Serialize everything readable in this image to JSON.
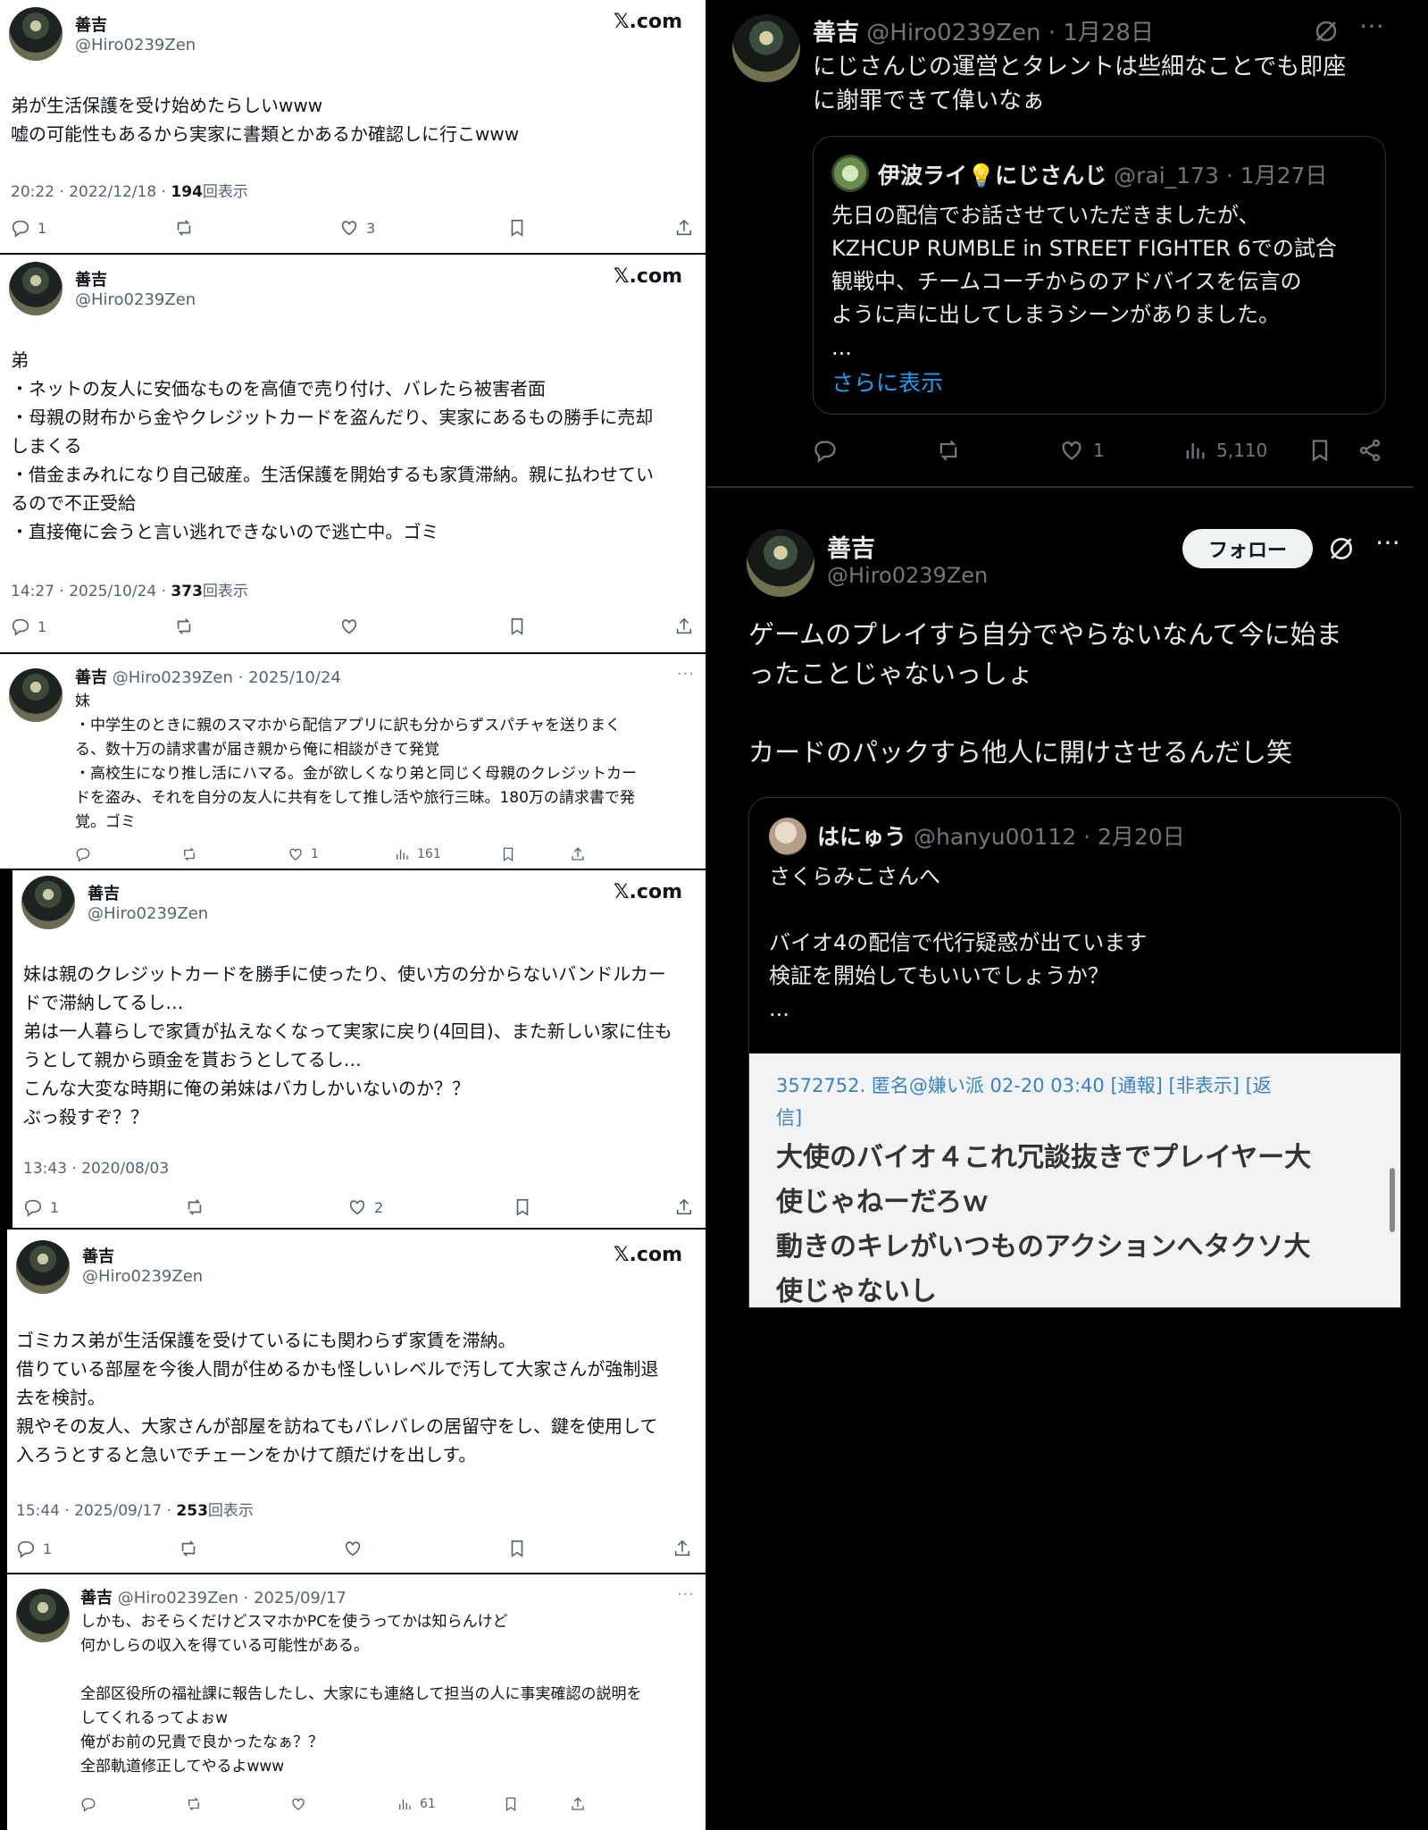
{
  "user": {
    "name": "善吉",
    "handle": "@Hiro0239Zen"
  },
  "xcom": "𝕏.com",
  "left": {
    "card1": {
      "body": "弟が生活保護を受け始めたらしいwww\n嘘の可能性もあるから実家に書類とかあるか確認しに行こwww",
      "time": "20:22 · 2022/12/18 · ",
      "views": "194",
      "views_suffix": "回表示",
      "replies": "1",
      "likes": "3"
    },
    "card2": {
      "body": "弟\n・ネットの友人に安価なものを高値で売り付け、バレたら被害者面\n・母親の財布から金やクレジットカードを盗んだり、実家にあるもの勝手に売却\nしまくる\n・借金まみれになり自己破産。生活保護を開始するも家賃滞納。親に払わせてい\nるので不正受給\n・直接俺に会うと言い逃れできないので逃亡中。ゴミ",
      "time": "14:27 · 2025/10/24 · ",
      "views": "373",
      "views_suffix": "回表示",
      "replies": "1"
    },
    "reply1": {
      "date": "· 2025/10/24",
      "body": "妹\n・中学生のときに親のスマホから配信アプリに訳も分からずスパチャを送りまく\nる、数十万の請求書が届き親から俺に相談がきて発覚\n・高校生になり推し活にハマる。金が欲しくなり弟と同じく母親のクレジットカー\nドを盗み、それを自分の友人に共有をして推し活や旅行三昧。180万の請求書で発\n覚。ゴミ",
      "likes": "1",
      "views": "161",
      "dots": "···"
    },
    "card3": {
      "body": "妹は親のクレジットカードを勝手に使ったり、使い方の分からないバンドルカー\nドで滞納してるし…\n弟は一人暮らしで家賃が払えなくなって実家に戻り(4回目)、また新しい家に住も\nうとして親から頭金を貰おうとしてるし…\nこんな大変な時期に俺の弟妹はバカしかいないのか？？\nぶっ殺すぞ？？",
      "time": "13:43 · 2020/08/03",
      "replies": "1",
      "likes": "2"
    },
    "card4": {
      "body": "ゴミカス弟が生活保護を受けているにも関わらず家賃を滞納。\n借りている部屋を今後人間が住めるかも怪しいレベルで汚して大家さんが強制退\n去を検討。\n親やその友人、大家さんが部屋を訪ねてもバレバレの居留守をし、鍵を使用して\n入ろうとすると急いでチェーンをかけて顔だけを出しす。",
      "time": "15:44 · 2025/09/17 · ",
      "views": "253",
      "views_suffix": "回表示",
      "replies": "1"
    },
    "reply2": {
      "date": "· 2025/09/17",
      "body": "しかも、おそらくだけどスマホかPCを使うってかは知らんけど\n何かしらの収入を得ている可能性がある。\n\n全部区役所の福祉課に報告したし、大家にも連絡して担当の人に事実確認の説明を\nしてくれるってよぉw\n俺がお前の兄貴で良かったなぁ？？\n全部軌道修正してやるよwww",
      "views": "61",
      "dots": "···"
    }
  },
  "right": {
    "tweet1": {
      "date": "· 1月28日",
      "body": "にじさんじの運営とタレントは些細なことでも即座\nに謝罪できて偉いなぁ",
      "quote": {
        "name": "伊波ライ💡にじさんじ",
        "handle": "@rai_173",
        "date": "· 1月27日",
        "body": "先日の配信でお話させていただきましたが、\nKZHCUP RUMBLE in STREET FIGHTER 6での試合\n観戦中、チームコーチからのアドバイスを伝言の\nように声に出してしまうシーンがありました。\n...",
        "more": "さらに表示"
      },
      "likes": "1",
      "views": "5,110"
    },
    "tweet2": {
      "follow": "フォロー",
      "body": "ゲームのプレイすら自分でやらないなんて今に始ま\nったことじゃないっしょ\n\nカードのパックすら他人に開けさせるんだし笑",
      "quote": {
        "name": "はにゅう",
        "handle": "@hanyu00112",
        "date": "· 2月20日",
        "body": "さくらみこさんへ\n\nバイオ4の配信で代行疑惑が出ています\n検証を開始してもいいでしょうか？\n...",
        "img_meta": "3572752. 匿名@嫌い派 02-20 03:40 [通報] [非表示] [返\n信]",
        "img_text": "大使のバイオ４これ冗談抜きでプレイヤー大\n使じゃねーだろｗ\n動きのキレがいつものアクションへタクソ大\n使じゃないし"
      }
    }
  }
}
